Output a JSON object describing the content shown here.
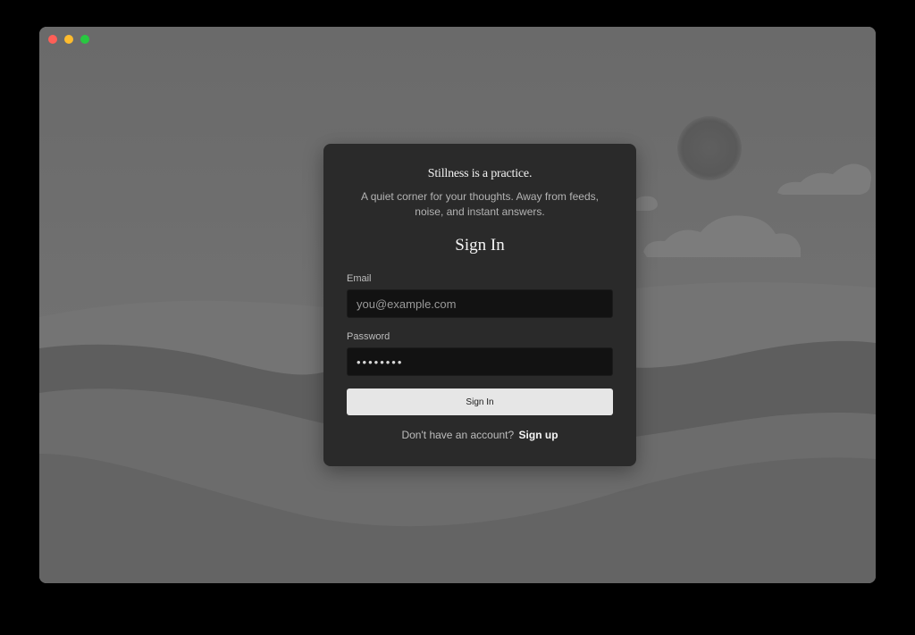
{
  "window": {
    "controls": [
      "close",
      "minimize",
      "maximize"
    ]
  },
  "card": {
    "tagline": "Stillness is a practice.",
    "subtext": "A quiet corner for your thoughts. Away from feeds, noise, and instant answers.",
    "heading": "Sign In",
    "email": {
      "label": "Email",
      "placeholder": "you@example.com",
      "value": ""
    },
    "password": {
      "label": "Password",
      "value": "••••••••"
    },
    "submit_label": "Sign In",
    "footer": {
      "prompt": "Don't have an account?",
      "link_label": "Sign up"
    }
  },
  "colors": {
    "card_bg": "#2a2a2a",
    "input_bg": "#121212",
    "button_bg": "#e6e6e6",
    "close": "#ff5f57",
    "minimize": "#febc2e",
    "maximize": "#28c840"
  },
  "icons": {
    "close": "window-close-icon",
    "minimize": "window-minimize-icon",
    "maximize": "window-maximize-icon"
  }
}
